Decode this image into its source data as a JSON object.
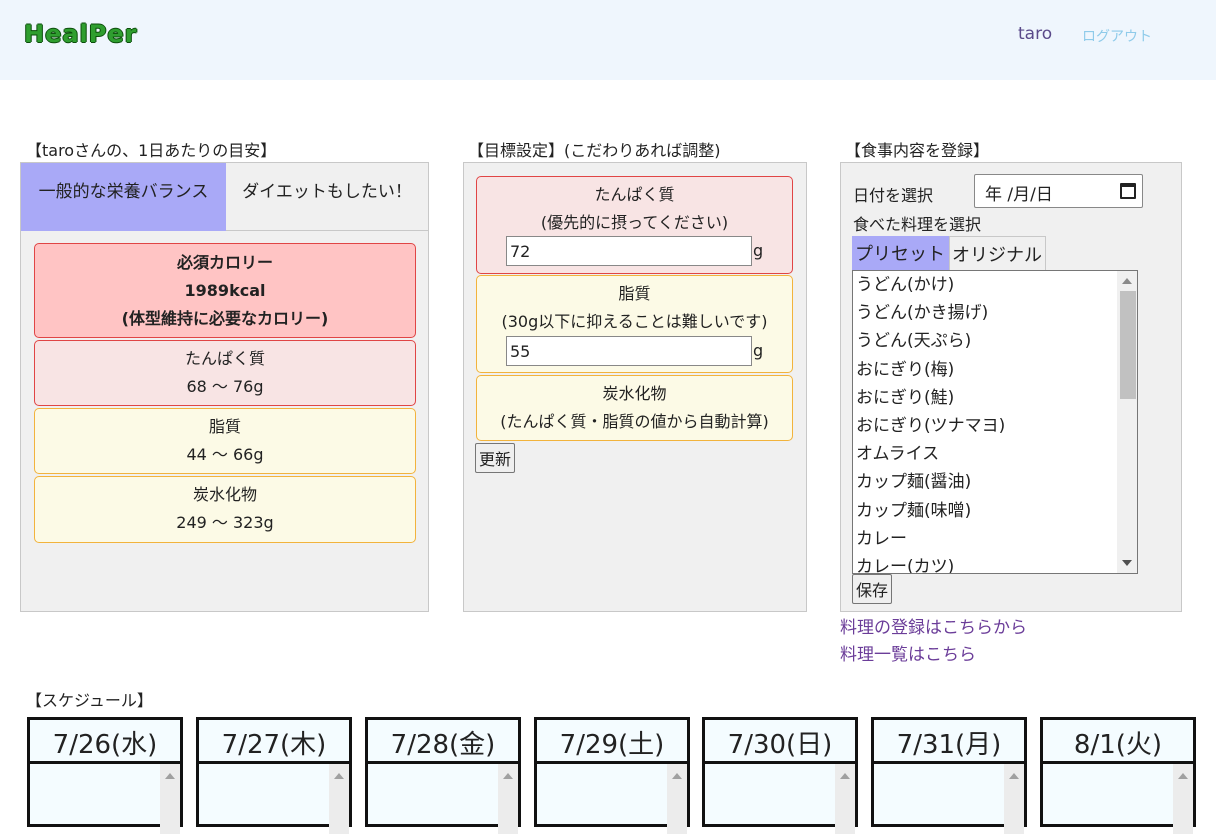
{
  "header": {
    "logo": "HealPer",
    "username": "taro",
    "logout_label": "ログアウト"
  },
  "guide": {
    "title": "【taroさんの、1日あたりの目安】",
    "tabs": [
      "一般的な栄養バランス",
      "ダイエットもしたい！"
    ],
    "calorie": {
      "label": "必須カロリー",
      "value": "1989kcal",
      "note": "(体型維持に必要なカロリー)"
    },
    "protein": {
      "label": "たんぱく質",
      "range": "68 ～ 76g"
    },
    "fat": {
      "label": "脂質",
      "range": "44 ～ 66g"
    },
    "carb": {
      "label": "炭水化物",
      "range": "249 ～ 323g"
    }
  },
  "goal": {
    "title": "【目標設定】(こだわりあれば調整)",
    "protein": {
      "label": "たんぱく質",
      "note": "(優先的に摂ってください)",
      "value": "72",
      "unit": "g"
    },
    "fat": {
      "label": "脂質",
      "note": "(30g以下に抑えることは難しいです)",
      "value": "55",
      "unit": "g"
    },
    "carb": {
      "label": "炭水化物",
      "note": "(たんぱく質・脂質の値から自動計算)"
    },
    "update_label": "更新"
  },
  "meal": {
    "title": "【食事内容を登録】",
    "date_label": "日付を選択",
    "date_placeholder": "年 /月/日",
    "dish_label": "食べた料理を選択",
    "tabs": [
      "プリセット",
      "オリジナル"
    ],
    "options": [
      "うどん(かけ)",
      "うどん(かき揚げ)",
      "うどん(天ぷら)",
      "おにぎり(梅)",
      "おにぎり(鮭)",
      "おにぎり(ツナマヨ)",
      "オムライス",
      "カップ麺(醤油)",
      "カップ麺(味噌)",
      "カレー",
      "カレー(カツ)"
    ],
    "save_label": "保存",
    "register_link": "料理の登録はこちらから",
    "list_link": "料理一覧はこちら"
  },
  "schedule": {
    "title": "【スケジュール】",
    "days": [
      "7/26(水)",
      "7/27(木)",
      "7/28(金)",
      "7/29(土)",
      "7/30(日)",
      "7/31(月)",
      "8/1(火)"
    ]
  }
}
